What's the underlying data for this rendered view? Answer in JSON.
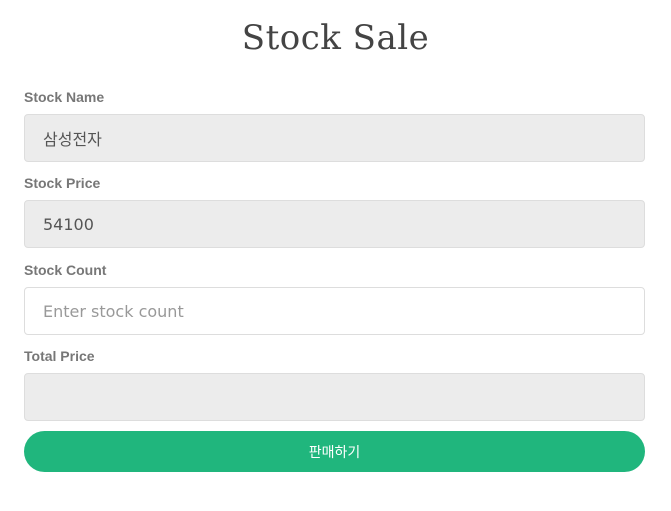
{
  "page": {
    "title": "Stock Sale"
  },
  "form": {
    "stock_name": {
      "label": "Stock Name",
      "value": "삼성전자"
    },
    "stock_price": {
      "label": "Stock Price",
      "value": "54100"
    },
    "stock_count": {
      "label": "Stock Count",
      "value": "",
      "placeholder": "Enter stock count"
    },
    "total_price": {
      "label": "Total Price",
      "value": ""
    },
    "submit_label": "판매하기"
  },
  "colors": {
    "accent": "#20b67d",
    "readonly_bg": "#ececec",
    "label": "#777777",
    "title": "#444444"
  }
}
